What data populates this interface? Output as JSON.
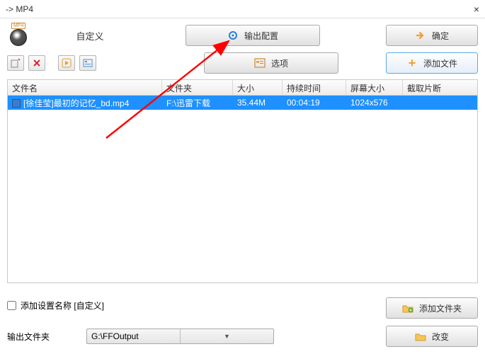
{
  "window": {
    "title": " -> MP4",
    "close": "×"
  },
  "format": {
    "badge": "MP4",
    "custom_label": "自定义"
  },
  "buttons": {
    "output_config": "输出配置",
    "ok": "确定",
    "options": "选项",
    "add_file": "添加文件",
    "add_folder": "添加文件夹",
    "change": "改变"
  },
  "table": {
    "headers": {
      "name": "文件名",
      "folder": "文件夹",
      "size": "大小",
      "duration": "持续时间",
      "screen": "屏幕大小",
      "clip": "截取片断"
    },
    "rows": [
      {
        "name": "[徐佳莹]最初的记忆_bd.mp4",
        "folder": "F:\\迅雷下载",
        "size": "35.44M",
        "duration": "00:04:19",
        "screen": "1024x576",
        "clip": ""
      }
    ]
  },
  "settings": {
    "add_preset_label": "添加设置名称 [自定义]",
    "output_folder_label": "输出文件夹",
    "output_folder_value": "G:\\FFOutput"
  }
}
